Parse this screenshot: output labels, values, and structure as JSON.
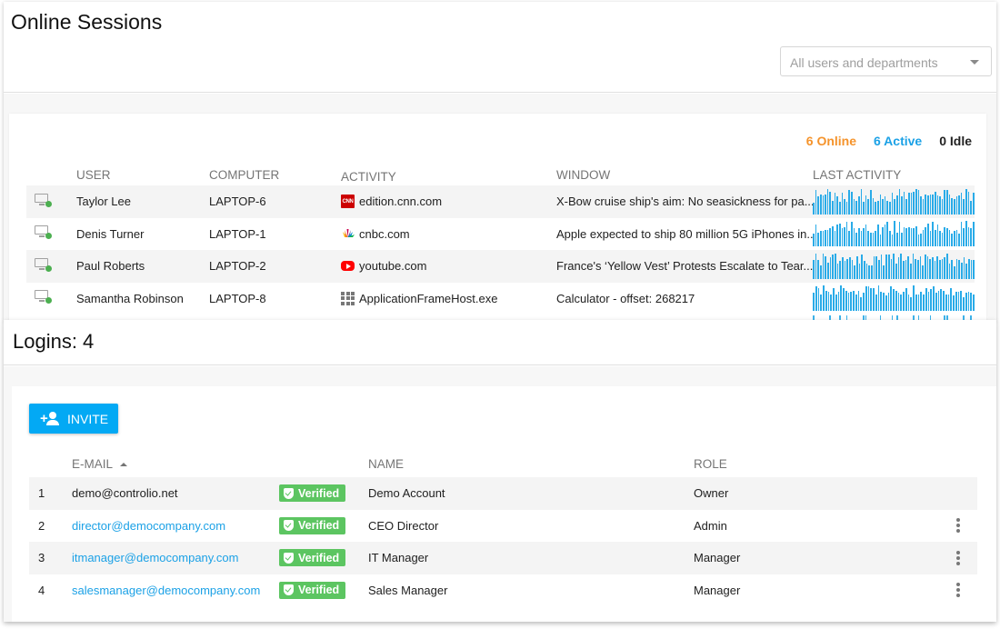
{
  "sessions": {
    "title": "Online Sessions",
    "filter": {
      "selected": "All users and departments"
    },
    "counts": {
      "online": "6 Online",
      "active": "6 Active",
      "idle": "0 Idle"
    },
    "colors": {
      "online": "#f5932b",
      "active": "#1ba1e6",
      "spark": "#29abe8",
      "status_dot": "#4caf50"
    },
    "columns": [
      "USER",
      "COMPUTER",
      "ACTIVITY",
      "WINDOW",
      "LAST ACTIVITY"
    ],
    "rows": [
      {
        "user": "Taylor Lee",
        "computer": "LAPTOP-6",
        "activity_icon": "cnn-icon",
        "activity": "edition.cnn.com",
        "window": "X-Bow cruise ship's aim: No seasickness for pa...",
        "last_activity": [
          0.45,
          0.95,
          0.7,
          0.8,
          0.75,
          0.78,
          1.0,
          0.9,
          0.55,
          0.85,
          0.7,
          0.5,
          0.85,
          0.6,
          0.5,
          0.95,
          0.9,
          0.6,
          0.55,
          0.7,
          1.0,
          0.5,
          0.75,
          0.6,
          0.95,
          0.65,
          0.5,
          0.55,
          0.8,
          0.6,
          0.7,
          0.55,
          0.5,
          0.85,
          0.6,
          0.75,
          1.0,
          0.7,
          0.9,
          0.6,
          0.85,
          0.85,
          0.9,
          1.0,
          0.95,
          0.7,
          0.6,
          0.8,
          0.75,
          0.8,
          0.8,
          0.9,
          0.75,
          0.7,
          0.6,
          0.95,
          0.95,
          0.8,
          0.65,
          0.6,
          0.7,
          0.75,
          0.85,
          0.6,
          1.0,
          0.9,
          0.55,
          0.85
        ]
      },
      {
        "user": "Denis Turner",
        "computer": "LAPTOP-1",
        "activity_icon": "cnbc-icon",
        "activity": "cnbc.com",
        "window": "Apple expected to ship 80 million 5G iPhones in...",
        "last_activity": [
          0.5,
          0.85,
          0.55,
          0.6,
          0.6,
          0.65,
          0.65,
          0.7,
          0.8,
          0.6,
          0.85,
          0.9,
          0.7,
          0.75,
          0.95,
          0.6,
          0.95,
          0.7,
          0.55,
          0.7,
          0.6,
          0.7,
          0.85,
          0.6,
          0.55,
          0.55,
          0.6,
          0.85,
          0.45,
          0.75,
          0.85,
          0.95,
          0.6,
          0.45,
          1.0,
          0.55,
          0.95,
          0.55,
          0.75,
          0.7,
          0.75,
          0.7,
          0.7,
          0.8,
          0.45,
          0.5,
          0.65,
          0.75,
          0.9,
          0.6,
          0.95,
          0.65,
          0.85,
          0.6,
          0.55,
          0.75,
          0.7,
          0.65,
          0.5,
          0.6,
          0.65,
          0.5,
          0.95,
          0.7,
          1.0,
          0.75,
          0.7,
          0.95
        ]
      },
      {
        "user": "Paul Roberts",
        "computer": "LAPTOP-2",
        "activity_icon": "youtube-icon",
        "activity": "youtube.com",
        "window": "France's ‘Yellow Vest’ Protests Escalate to Tear...",
        "last_activity": [
          0.75,
          1.0,
          0.75,
          0.55,
          1.0,
          0.9,
          0.65,
          0.85,
          0.95,
          1.0,
          0.6,
          0.7,
          0.85,
          0.7,
          0.8,
          0.85,
          0.75,
          0.55,
          0.9,
          0.6,
          0.95,
          0.7,
          0.6,
          0.55,
          0.55,
          0.9,
          0.9,
          0.75,
          0.95,
          0.55,
          0.95,
          0.95,
          0.8,
          1.0,
          0.6,
          0.85,
          1.0,
          0.7,
          0.75,
          0.9,
          0.6,
          1.0,
          0.8,
          0.75,
          0.9,
          0.55,
          0.95,
          0.9,
          0.8,
          0.85,
          0.7,
          0.9,
          0.75,
          0.8,
          0.85,
          1.0,
          0.6,
          0.75,
          0.5,
          0.8,
          0.75,
          0.65,
          0.85,
          0.6,
          0.8,
          0.75,
          0.75
        ]
      },
      {
        "user": "Samantha Robinson",
        "computer": "LAPTOP-8",
        "activity_icon": "app-grid-icon",
        "activity": "ApplicationFrameHost.exe",
        "window": "Calculator - offset: 268217",
        "last_activity": [
          0.7,
          0.95,
          0.9,
          0.65,
          1.0,
          0.8,
          0.75,
          0.65,
          0.9,
          0.65,
          0.75,
          1.0,
          0.9,
          0.8,
          0.7,
          0.75,
          0.8,
          0.65,
          0.8,
          0.55,
          0.7,
          0.95,
          0.95,
          0.9,
          0.9,
          0.65,
          1.0,
          0.75,
          0.7,
          0.6,
          0.7,
          0.95,
          0.85,
          0.8,
          0.7,
          0.65,
          0.75,
          0.9,
          0.65,
          0.55,
          1.0,
          0.65,
          0.65,
          0.75,
          0.65,
          0.9,
          0.75,
          0.85,
          0.95,
          0.7,
          0.8,
          0.85,
          0.8,
          0.65,
          0.65,
          0.9,
          0.6,
          0.75,
          0.75,
          0.8,
          0.55,
          0.7,
          0.75,
          0.7,
          0.65
        ]
      }
    ]
  },
  "logins": {
    "title": "Logins: 4",
    "invite_label": "INVITE",
    "columns": {
      "email": "E-MAIL",
      "name": "NAME",
      "role": "ROLE"
    },
    "sort": {
      "column": "email",
      "direction": "ascending"
    },
    "badge_color": "#5cc561",
    "link_color": "#1ba1e6",
    "rows": [
      {
        "num": "1",
        "email": "demo@controlio.net",
        "email_is_link": false,
        "badge": "Verified",
        "name": "Demo Account",
        "role": "Owner",
        "has_menu": false
      },
      {
        "num": "2",
        "email": "director@democompany.com",
        "email_is_link": true,
        "badge": "Verified",
        "name": "CEO Director",
        "role": "Admin",
        "has_menu": true
      },
      {
        "num": "3",
        "email": "itmanager@democompany.com",
        "email_is_link": true,
        "badge": "Verified",
        "name": "IT Manager",
        "role": "Manager",
        "has_menu": true
      },
      {
        "num": "4",
        "email": "salesmanager@democompany.com",
        "email_is_link": true,
        "badge": "Verified",
        "name": "Sales Manager",
        "role": "Manager",
        "has_menu": true
      }
    ]
  }
}
